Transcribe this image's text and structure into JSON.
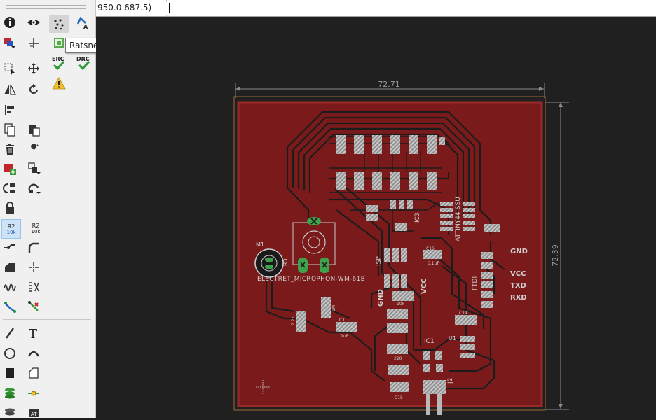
{
  "toolbar": {
    "tooltip": "Ratsnest",
    "erc_label": "ERC",
    "drc_label": "DRC",
    "value_label_r2": "R2",
    "value_label_10k": "10k",
    "icons": [
      "info-icon",
      "eye-icon",
      "ratsnest-icon",
      "autorouter-icon",
      "layer-settings-icon",
      "mark-icon",
      "erc-icon",
      "drc-icon",
      "warning-icon",
      "select-icon",
      "move-icon",
      "mirror-icon",
      "rotate-icon",
      "align-icon",
      "copy-icon",
      "paste-icon",
      "delete-icon",
      "wrench-icon",
      "add-icon",
      "replace-icon",
      "swap-icon",
      "change-icon",
      "lock-icon",
      "name-icon",
      "value-icon",
      "split-icon",
      "miter-icon",
      "optimize-icon",
      "meander-icon",
      "ripup-icon",
      "route-icon",
      "ripup-single-icon",
      "line-icon",
      "text-icon",
      "circle-icon",
      "arc-icon",
      "rectangle-icon",
      "polygon-icon",
      "via-icon",
      "signal-icon",
      "hole-icon",
      "attribute-icon"
    ]
  },
  "command_bar": {
    "coordinates": "950.0 687.5)",
    "input_value": ""
  },
  "board": {
    "width_dimension": "72.71",
    "height_dimension": "72.39",
    "labels": {
      "m1": "M1",
      "r3": "R3",
      "mic": "ELECTRET_MICROPHON-WM-61B",
      "isp": "ISP",
      "gnd_a": "GND",
      "vcc_a": "VCC",
      "gnd_b": "GND",
      "vcc_b": "VCC",
      "txd": "TXD",
      "rxd": "RXD",
      "ftdi": "FTDI",
      "ic1": "IC1",
      "ic3": "IC3",
      "u1": "U1",
      "j2": "J2",
      "attiny": "ATTINY44-SSU",
      "c15": "C15",
      "c16": "C16",
      "c14": "C14",
      "c1": "C1",
      "c16_val": "0.1uF",
      "c1_val": "1uF",
      "r10k": "10k",
      "r100": "100",
      "r220": "220",
      "r22k": "2.2k",
      "r1m": "1M",
      "s1": "S1"
    },
    "colors": {
      "board": "#7a1a1a",
      "board_edge": "#a06a3a",
      "pad": "#b8b8b8",
      "trace_gap": "#1a1a1a",
      "dimension": "#8a8a8a",
      "green_pad": "#3fa34d"
    }
  }
}
